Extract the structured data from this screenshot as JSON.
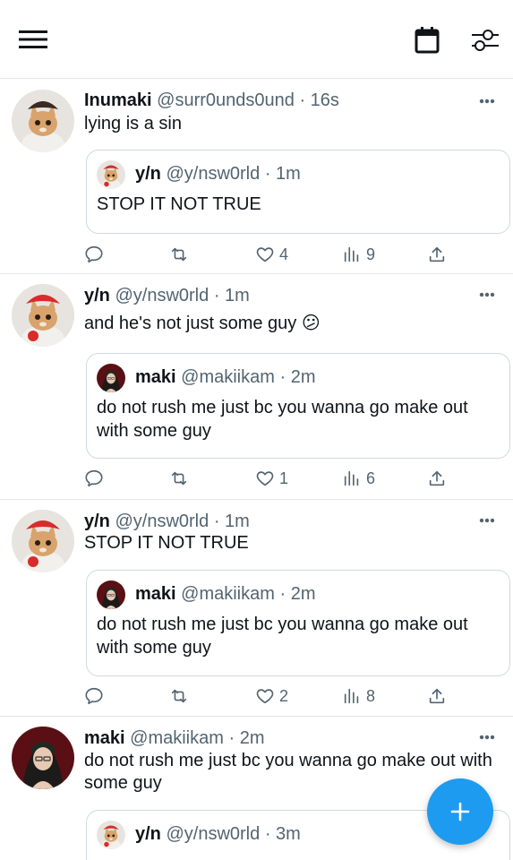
{
  "topbar": {
    "menu_icon": "hamburger-menu-icon",
    "calendar_icon": "calendar-icon",
    "filter_icon": "sliders-icon"
  },
  "tweets": [
    {
      "name": "Inumaki",
      "handle": "@surr0unds0und",
      "sep": "·",
      "time": "16s",
      "text": "lying is a sin",
      "quote": {
        "name": "y/n",
        "handle": "@y/nsw0rld",
        "sep": "·",
        "time": "1m",
        "text": "STOP IT NOT TRUE"
      },
      "stats": {
        "replies": "",
        "retweets": "",
        "likes": "4",
        "views": "9"
      }
    },
    {
      "name": "y/n",
      "handle": "@y/nsw0rld",
      "sep": "·",
      "time": "1m",
      "text": "and he's not just some guy 😕",
      "quote": {
        "name": "maki",
        "handle": "@makiikam",
        "sep": "·",
        "time": "2m",
        "text": "do not rush me just bc you wanna go make out with some guy"
      },
      "stats": {
        "replies": "",
        "retweets": "",
        "likes": "1",
        "views": "6"
      }
    },
    {
      "name": "y/n",
      "handle": "@y/nsw0rld",
      "sep": "·",
      "time": "1m",
      "text": "STOP IT NOT TRUE",
      "quote": {
        "name": "maki",
        "handle": "@makiikam",
        "sep": "·",
        "time": "2m",
        "text": "do not rush me just bc you wanna go make out with some guy"
      },
      "stats": {
        "replies": "",
        "retweets": "",
        "likes": "2",
        "views": "8"
      }
    },
    {
      "name": "maki",
      "handle": "@makiikam",
      "sep": "·",
      "time": "2m",
      "text": "do not rush me just bc you wanna go make out with some guy",
      "quote": {
        "name": "y/n",
        "handle": "@y/nsw0rld",
        "sep": "·",
        "time": "3m",
        "text": ""
      }
    }
  ],
  "fab": {
    "icon": "plus-icon"
  },
  "colors": {
    "accent": "#1d9bf0",
    "muted": "#536471",
    "text": "#0f1419",
    "divider": "#e6e6e6"
  }
}
